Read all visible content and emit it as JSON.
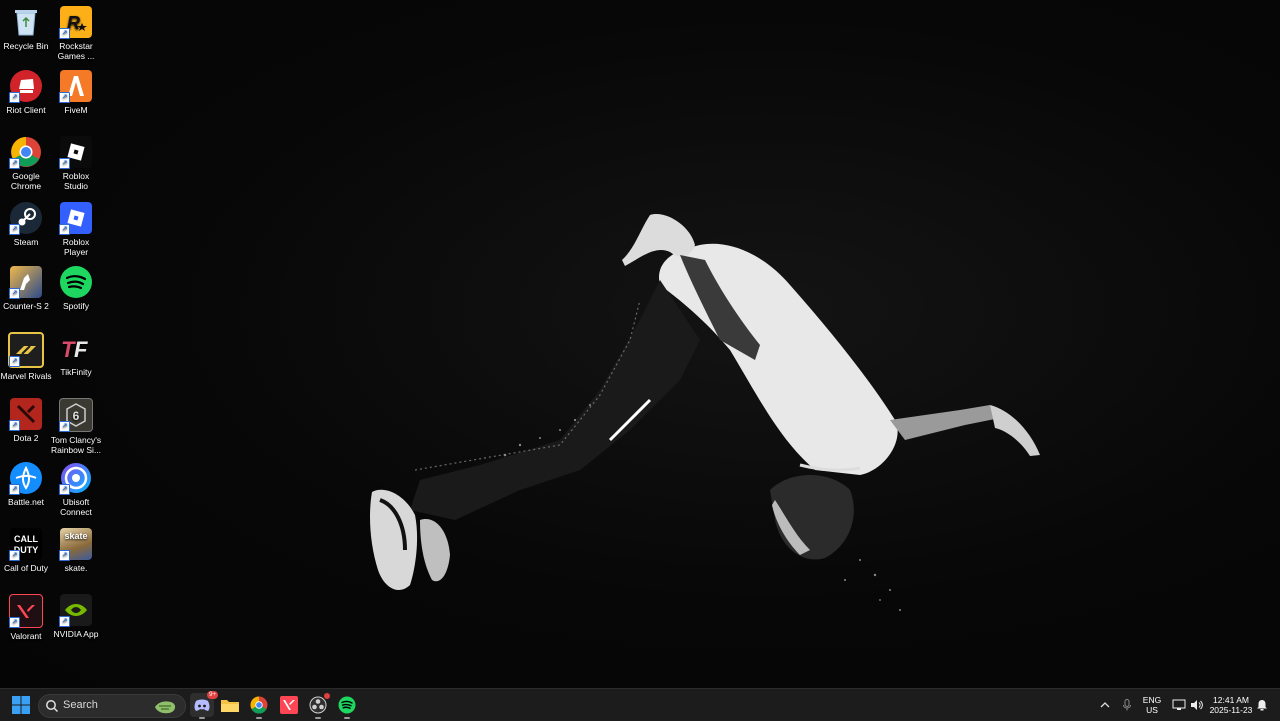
{
  "desktop": {
    "icons": [
      {
        "label": "Recycle Bin"
      },
      {
        "label": "Rockstar Games ..."
      },
      {
        "label": "Riot Client"
      },
      {
        "label": "FiveM"
      },
      {
        "label": "Google Chrome"
      },
      {
        "label": "Roblox Studio"
      },
      {
        "label": "Steam"
      },
      {
        "label": "Roblox Player"
      },
      {
        "label": "Counter-S 2"
      },
      {
        "label": "Spotify"
      },
      {
        "label": "Marvel Rivals"
      },
      {
        "label": "TikFinity"
      },
      {
        "label": "Dota 2"
      },
      {
        "label": "Tom Clancy's Rainbow Si..."
      },
      {
        "label": "Battle.net"
      },
      {
        "label": "Ubisoft Connect"
      },
      {
        "label": "Call of Duty"
      },
      {
        "label": "skate."
      },
      {
        "label": "Valorant"
      },
      {
        "label": "NVIDIA App"
      }
    ]
  },
  "taskbar": {
    "search_placeholder": "Search",
    "pinned": [
      {
        "name": "start",
        "icon": "windows-icon"
      },
      {
        "name": "discord",
        "icon": "discord-icon",
        "badge": "9+"
      },
      {
        "name": "file-explorer",
        "icon": "folder-icon"
      },
      {
        "name": "chrome",
        "icon": "chrome-icon"
      },
      {
        "name": "valorant",
        "icon": "valorant-icon"
      },
      {
        "name": "obs",
        "icon": "obs-icon"
      },
      {
        "name": "spotify",
        "icon": "spotify-icon"
      }
    ],
    "tray": {
      "lang_line1": "ENG",
      "lang_line2": "US",
      "time": "12:41 AM",
      "date": "2025-11-23"
    }
  },
  "colors": {
    "taskbar_bg": "#1c1c1c",
    "accent_blue": "#0078d4",
    "wallpaper_bg": "#070707"
  }
}
